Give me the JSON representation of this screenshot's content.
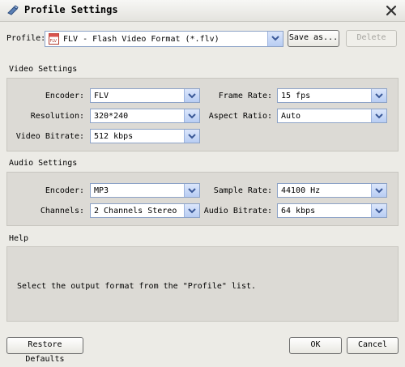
{
  "window": {
    "title": "Profile Settings"
  },
  "profile": {
    "label": "Profile:",
    "value": "FLV - Flash Video Format (*.flv)",
    "save_as": "Save as...",
    "delete": "Delete"
  },
  "video": {
    "section_title": "Video Settings",
    "encoder_label": "Encoder:",
    "encoder_value": "FLV",
    "resolution_label": "Resolution:",
    "resolution_value": "320*240",
    "bitrate_label": "Video Bitrate:",
    "bitrate_value": "512 kbps",
    "frame_rate_label": "Frame Rate:",
    "frame_rate_value": "15 fps",
    "aspect_label": "Aspect Ratio:",
    "aspect_value": "Auto"
  },
  "audio": {
    "section_title": "Audio Settings",
    "encoder_label": "Encoder:",
    "encoder_value": "MP3",
    "channels_label": "Channels:",
    "channels_value": "2 Channels Stereo",
    "sample_rate_label": "Sample Rate:",
    "sample_rate_value": "44100 Hz",
    "bitrate_label": "Audio Bitrate:",
    "bitrate_value": "64 kbps"
  },
  "help": {
    "section_title": "Help",
    "text": "Select the output format from the \"Profile\" list."
  },
  "footer": {
    "restore_defaults": "Restore Defaults",
    "ok": "OK",
    "cancel": "Cancel"
  }
}
